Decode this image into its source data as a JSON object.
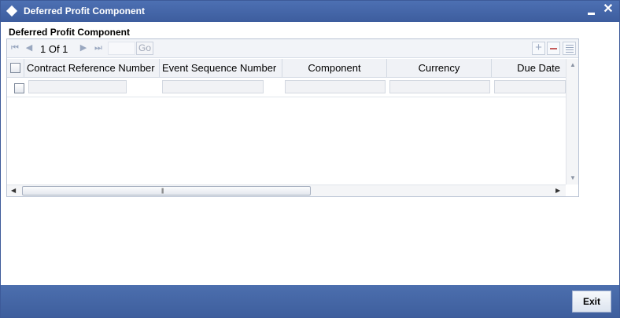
{
  "window": {
    "title": "Deferred Profit Component",
    "minimize_icon": "minimize-icon",
    "close_icon": "close-icon",
    "close_glyph": "✕"
  },
  "section": {
    "title": "Deferred Profit Component"
  },
  "pager": {
    "first_glyph": "⏮",
    "prev_glyph": "◀",
    "page_text": "1 Of 1",
    "next_glyph": "▶",
    "last_glyph": "⏭",
    "page_input_value": "",
    "go_label": "Go"
  },
  "toolbar": {
    "add_glyph": "+",
    "add_icon": "add-row-icon",
    "delete_icon": "delete-row-icon",
    "view_icon": "single-record-view-icon"
  },
  "grid": {
    "columns": [
      "Contract Reference Number",
      "Event Sequence Number",
      "Component",
      "Currency",
      "Due Date"
    ],
    "rows": [
      {
        "selected": false,
        "contract_reference_number": "",
        "event_sequence_number": "",
        "component": "",
        "currency": "",
        "due_date": ""
      }
    ]
  },
  "scrollbars": {
    "up_glyph": "▲",
    "down_glyph": "▼",
    "left_glyph": "◀",
    "right_glyph": "▶",
    "grip_glyph": "|||"
  },
  "footer": {
    "exit_label": "Exit"
  },
  "colors": {
    "titlebar": "#3d5d9e",
    "footer": "#3e5e9d",
    "delete_accent": "#c45b5b"
  }
}
